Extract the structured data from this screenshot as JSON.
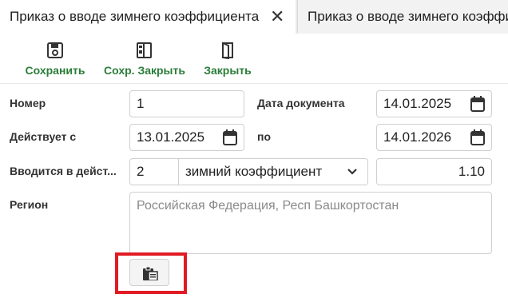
{
  "tabs": [
    {
      "label": "Приказ о вводе зимнего коэффициента",
      "active": true
    },
    {
      "label": "Приказ о вводе зимнего коэффициента",
      "active": false
    }
  ],
  "toolbar": {
    "save_label": "Сохранить",
    "save_close_label": "Сохр. Закрыть",
    "close_label": "Закрыть"
  },
  "form": {
    "number_label": "Номер",
    "number_value": "1",
    "doc_date_label": "Дата документа",
    "doc_date_value": "14.01.2025",
    "valid_from_label": "Действует с",
    "valid_from_value": "13.01.2025",
    "valid_to_label": "по",
    "valid_to_value": "14.01.2026",
    "introduced_label": "Вводится в дейст...",
    "introduced_number": "2",
    "introduced_type": "зимний коэффициент",
    "coefficient_value": "1.10",
    "region_label": "Регион",
    "region_placeholder": "Российская Федерация, Респ Башкортостан"
  },
  "colors": {
    "accent_green": "#2b7d3a",
    "highlight_red": "#e01b24"
  },
  "icons": {
    "save": "floppy-disk-icon",
    "save_close": "save-close-icon",
    "close": "door-close-icon",
    "calendar": "calendar-icon",
    "dropdown": "chevron-down-icon",
    "clipboard": "clipboard-icon"
  }
}
